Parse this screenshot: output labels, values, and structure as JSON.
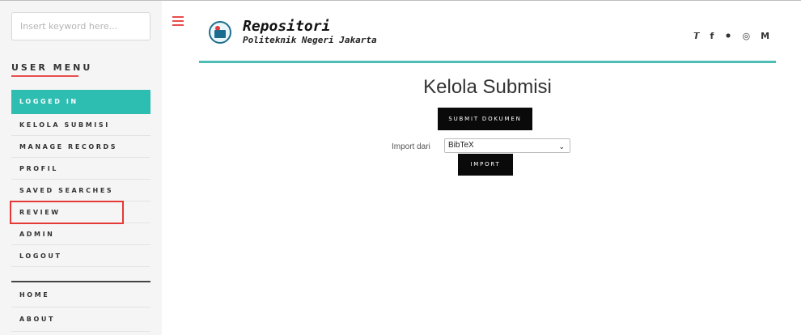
{
  "search": {
    "placeholder": "Insert keyword here..."
  },
  "sidebar": {
    "menu_title": "USER MENU",
    "items": [
      {
        "label": "LOGGED IN"
      },
      {
        "label": "KELOLA SUBMISI"
      },
      {
        "label": "MANAGE RECORDS"
      },
      {
        "label": "PROFIL"
      },
      {
        "label": "SAVED SEARCHES"
      },
      {
        "label": "REVIEW"
      },
      {
        "label": "ADMIN"
      },
      {
        "label": "LOGOUT"
      }
    ],
    "nav": [
      {
        "label": "HOME"
      },
      {
        "label": "ABOUT"
      }
    ]
  },
  "header": {
    "brand_title": "Repositori",
    "brand_subtitle": "Politeknik Negeri Jakarta",
    "social_icons": [
      "twitter-icon",
      "facebook-icon",
      "snapchat-icon",
      "instagram-icon",
      "medium-icon"
    ]
  },
  "main": {
    "title": "Kelola Submisi",
    "submit_label": "SUBMIT DOKUMEN",
    "import_label": "Import dari",
    "import_value": "BibTeX",
    "import_button": "IMPORT"
  },
  "colors": {
    "accent": "#2ebdb1",
    "menu_underline": "#e84e4e",
    "highlight_box": "#e53935",
    "button": "#0a0a0a"
  }
}
